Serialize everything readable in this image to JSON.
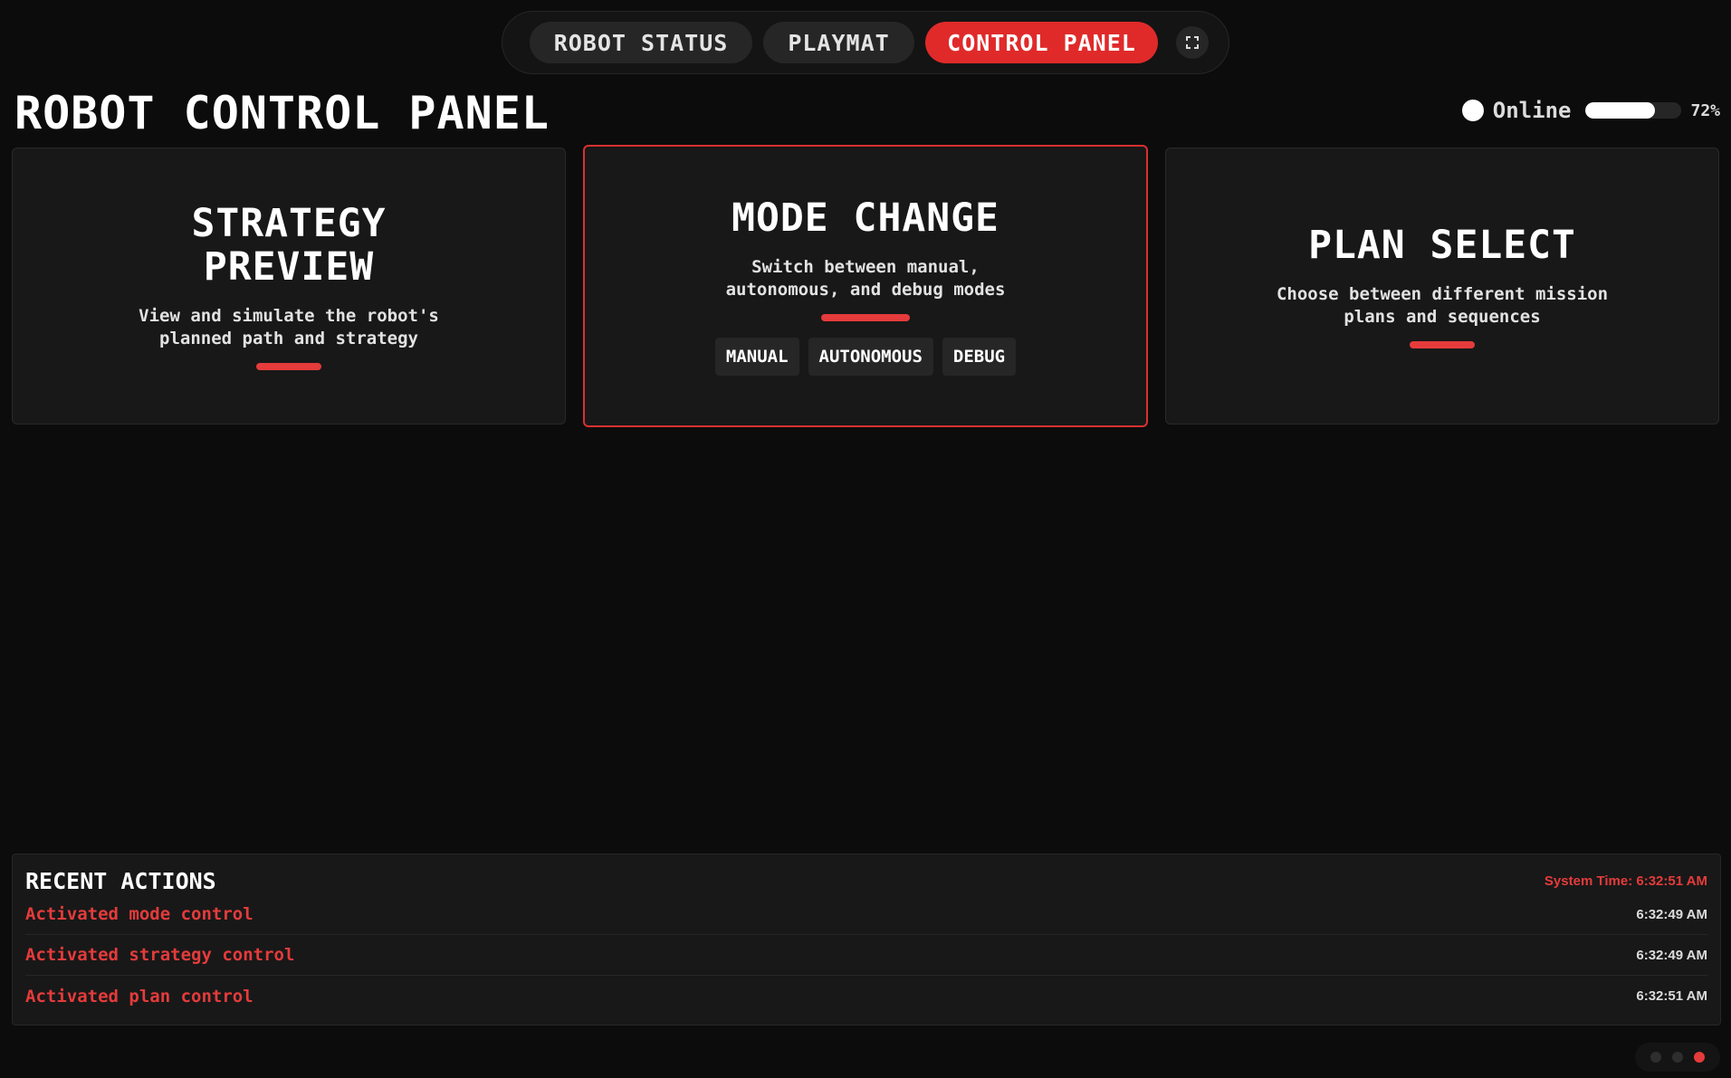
{
  "nav": {
    "tabs": [
      {
        "label": "ROBOT STATUS",
        "active": false
      },
      {
        "label": "PLAYMAT",
        "active": false
      },
      {
        "label": "CONTROL PANEL",
        "active": true
      }
    ],
    "expand_icon": "expand-icon"
  },
  "header": {
    "title": "ROBOT CONTROL PANEL",
    "status_label": "Online",
    "battery_percent": 72,
    "battery_label": "72%"
  },
  "cards": [
    {
      "title": "STRATEGY PREVIEW",
      "description": "View and simulate the robot's planned path and strategy",
      "active": false
    },
    {
      "title": "MODE CHANGE",
      "description": "Switch between manual, autonomous, and debug modes",
      "active": true,
      "buttons": [
        "MANUAL",
        "AUTONOMOUS",
        "DEBUG"
      ]
    },
    {
      "title": "PLAN SELECT",
      "description": "Choose between different mission plans and sequences",
      "active": false
    }
  ],
  "recent_actions": {
    "title": "RECENT ACTIONS",
    "system_time": "System Time: 6:32:51 AM",
    "items": [
      {
        "text": "Activated mode control",
        "time": "6:32:49 AM"
      },
      {
        "text": "Activated strategy control",
        "time": "6:32:49 AM"
      },
      {
        "text": "Activated plan control",
        "time": "6:32:51 AM"
      }
    ]
  },
  "pagination": {
    "count": 3,
    "active_index": 2
  },
  "colors": {
    "accent": "#e02a2a",
    "background": "#0c0c0c",
    "card": "#181818",
    "button": "#262626"
  }
}
